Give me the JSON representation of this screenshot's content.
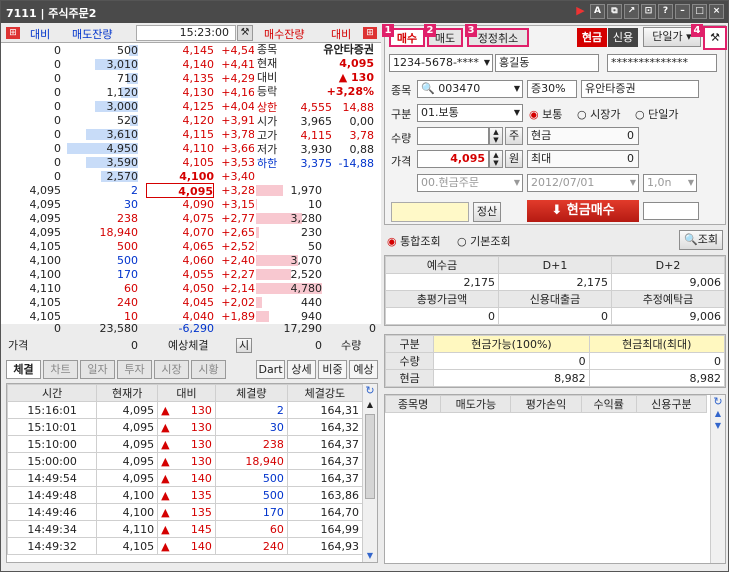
{
  "window": {
    "title": "7111 | 주식주문2"
  },
  "orderbook": {
    "header": {
      "buy_label": "대비",
      "sell_remain": "매도잔량",
      "time": "15:23:00",
      "buy_remain": "매수잔량",
      "vs_label": "대비"
    },
    "asks": [
      {
        "qty": "0",
        "remain": "500",
        "price": "4,145",
        "chg": "+4,54"
      },
      {
        "qty": "0",
        "remain": "3,010",
        "price": "4,140",
        "chg": "+4,41"
      },
      {
        "qty": "0",
        "remain": "710",
        "price": "4,135",
        "chg": "+4,29"
      },
      {
        "qty": "0",
        "remain": "1,120",
        "price": "4,130",
        "chg": "+4,16"
      },
      {
        "qty": "0",
        "remain": "3,000",
        "price": "4,125",
        "chg": "+4,04"
      },
      {
        "qty": "0",
        "remain": "520",
        "price": "4,120",
        "chg": "+3,91"
      },
      {
        "qty": "0",
        "remain": "3,610",
        "price": "4,115",
        "chg": "+3,78"
      },
      {
        "qty": "0",
        "remain": "4,950",
        "price": "4,110",
        "chg": "+3,66"
      },
      {
        "qty": "0",
        "remain": "3,590",
        "price": "4,105",
        "chg": "+3,53"
      },
      {
        "qty": "0",
        "remain": "2,570",
        "price": "4,100",
        "chg": "+3,40"
      }
    ],
    "ask_bar_fill": [
      0.12,
      0.6,
      0.15,
      0.23,
      0.6,
      0.11,
      0.72,
      0.98,
      0.72,
      0.52
    ],
    "bids": [
      {
        "qty": "4,095",
        "remain": "2",
        "price": "4,095",
        "chg": "+3,28",
        "buy": "1,970"
      },
      {
        "qty": "4,095",
        "remain": "30",
        "price": "4,090",
        "chg": "+3,15",
        "buy": "10"
      },
      {
        "qty": "4,095",
        "remain": "238",
        "price": "4,075",
        "chg": "+2,77",
        "buy": "3,280"
      },
      {
        "qty": "4,095",
        "remain": "18,940",
        "price": "4,070",
        "chg": "+2,65",
        "buy": "230"
      },
      {
        "qty": "4,105",
        "remain": "500",
        "price": "4,065",
        "chg": "+2,52",
        "buy": "50"
      },
      {
        "qty": "4,100",
        "remain": "500",
        "price": "4,060",
        "chg": "+2,40",
        "buy": "3,070"
      },
      {
        "qty": "4,100",
        "remain": "170",
        "price": "4,055",
        "chg": "+2,27",
        "buy": "2,520"
      },
      {
        "qty": "4,110",
        "remain": "60",
        "price": "4,050",
        "chg": "+2,14",
        "buy": "4,780"
      },
      {
        "qty": "4,105",
        "remain": "240",
        "price": "4,045",
        "chg": "+2,02",
        "buy": "440"
      },
      {
        "qty": "4,105",
        "remain": "10",
        "price": "4,040",
        "chg": "+1,89",
        "buy": "940"
      }
    ],
    "bid_bar_fill": [
      0.41,
      0.02,
      0.69,
      0.05,
      0.01,
      0.64,
      0.53,
      1.0,
      0.09,
      0.2
    ],
    "info": {
      "rows": [
        {
          "k": "종목",
          "v": "유안타증권"
        },
        {
          "k": "현재",
          "v": "4,095"
        },
        {
          "k": "대비",
          "v": "▲ 130"
        },
        {
          "k": "등락",
          "v": "+3,28%"
        }
      ],
      "stats": [
        {
          "k": "상한",
          "a": "4,555",
          "b": "14,88"
        },
        {
          "k": "시가",
          "a": "3,965",
          "b": "0,00"
        },
        {
          "k": "고가",
          "a": "4,115",
          "b": "3,78"
        },
        {
          "k": "저가",
          "a": "3,930",
          "b": "0,88"
        },
        {
          "k": "하한",
          "a": "3,375",
          "b": "-14,88"
        }
      ]
    },
    "totals": {
      "left": "0",
      "sell": "23,580",
      "diff": "-6,290",
      "buy": "17,290",
      "right": "0"
    },
    "footer": {
      "price_label": "가격",
      "price": "0",
      "expected": "예상체결",
      "si": "시",
      "zero": "0",
      "qty_label": "수량"
    }
  },
  "bottom_tabs": [
    "체결",
    "차트",
    "일자",
    "투자",
    "시장",
    "시황"
  ],
  "bottom_btns": [
    "Dart",
    "상세",
    "비중",
    "예상"
  ],
  "trades": {
    "headers": [
      "시간",
      "현재가",
      "대비",
      "체결량",
      "체결강도"
    ],
    "rows": [
      [
        "15:16:01",
        "4,095",
        "130",
        "2",
        "164,31"
      ],
      [
        "15:10:01",
        "4,095",
        "130",
        "30",
        "164,32"
      ],
      [
        "15:10:00",
        "4,095",
        "130",
        "238",
        "164,37"
      ],
      [
        "15:00:00",
        "4,095",
        "130",
        "18,940",
        "164,37"
      ],
      [
        "14:49:54",
        "4,095",
        "140",
        "500",
        "164,37"
      ],
      [
        "14:49:48",
        "4,100",
        "135",
        "500",
        "163,86"
      ],
      [
        "14:49:46",
        "4,100",
        "135",
        "170",
        "164,70"
      ],
      [
        "14:49:34",
        "4,110",
        "145",
        "60",
        "164,99"
      ],
      [
        "14:49:32",
        "4,105",
        "140",
        "240",
        "164,93"
      ]
    ]
  },
  "order": {
    "tabs": [
      "매수",
      "매도",
      "정정취소"
    ],
    "badges": [
      "1",
      "2",
      "3",
      "4"
    ],
    "mode_cash": "현금",
    "mode_credit": "신용",
    "single_price": "단일가",
    "account": "1234-5678-****",
    "owner": "홍길동",
    "password": "**************",
    "stock_label": "종목",
    "stock_code": "003470",
    "margin": "증30%",
    "stock_name": "유안타증권",
    "type_label": "구분",
    "type_value": "01.보통",
    "radios": [
      "보통",
      "시장가",
      "단일가"
    ],
    "qty_label": "수량",
    "qty_unit": "주",
    "cash_label": "현금",
    "cash_val": "0",
    "price_label": "가격",
    "price_val": "4,095",
    "price_unit": "원",
    "max_label": "최대",
    "max_val": "0",
    "order_type": "00.현금주문",
    "date": "2012/07/01",
    "on": "1,0n",
    "settle": "정산",
    "submit": "현금매수"
  },
  "query": {
    "radio1": "통합조회",
    "radio2": "기본조회",
    "btn": "조회",
    "deposit_headers": [
      "예수금",
      "D+1",
      "D+2"
    ],
    "deposit_vals": [
      "2,175",
      "2,175",
      "9,006"
    ],
    "eval_headers": [
      "총평가금액",
      "신용대출금",
      "추정예탁금"
    ],
    "eval_vals": [
      "0",
      "0",
      "9,006"
    ],
    "avail_headers": [
      "구분",
      "현금가능(100%)",
      "현금최대(최대)"
    ],
    "avail_rows": [
      [
        "수량",
        "0",
        "0"
      ],
      [
        "현금",
        "8,982",
        "8,982"
      ]
    ],
    "holdings_headers": [
      "종목명",
      "매도가능",
      "평가손익",
      "수익률",
      "신용구분"
    ]
  },
  "colors": {
    "up": "#d40000",
    "down": "#0033cc",
    "accent": "#e0206a",
    "bar_pink": "#f8c8d0",
    "bar_blue": "#c8dcf8"
  }
}
